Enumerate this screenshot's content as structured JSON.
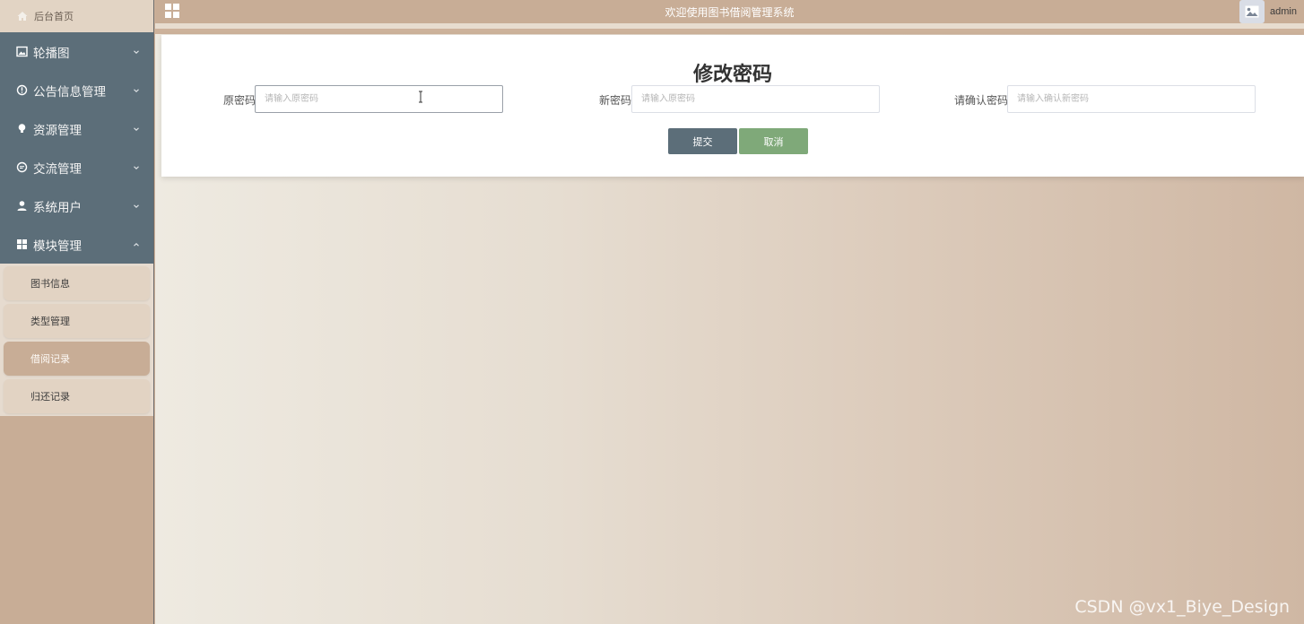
{
  "sidebar": {
    "home": "后台首页",
    "menu": [
      {
        "label": "轮播图",
        "icon": "picture-icon"
      },
      {
        "label": "公告信息管理",
        "icon": "info-circle-icon"
      },
      {
        "label": "资源管理",
        "icon": "bulb-icon"
      },
      {
        "label": "交流管理",
        "icon": "chat-icon"
      },
      {
        "label": "系统用户",
        "icon": "user-icon"
      },
      {
        "label": "模块管理",
        "icon": "grid-icon"
      }
    ],
    "submenu": [
      "图书信息",
      "类型管理",
      "借阅记录",
      "归还记录"
    ],
    "active_submenu": "借阅记录"
  },
  "topbar": {
    "title": "欢迎使用图书借阅管理系统",
    "username": "admin"
  },
  "form": {
    "title": "修改密码",
    "old_password_label": "原密码",
    "old_password_placeholder": "请输入原密码",
    "new_password_label": "新密码",
    "new_password_placeholder": "请输入原密码",
    "confirm_password_label": "请确认密码",
    "confirm_password_placeholder": "请输入确认新密码",
    "submit_label": "提交",
    "cancel_label": "取消"
  },
  "watermark": "CSDN @vx1_Biye_Design",
  "colors": {
    "sidebar_menu": "#5c6e79",
    "topbar": "#c8ad96",
    "submit_button": "#5c6e79",
    "cancel_button": "#7fa979"
  }
}
